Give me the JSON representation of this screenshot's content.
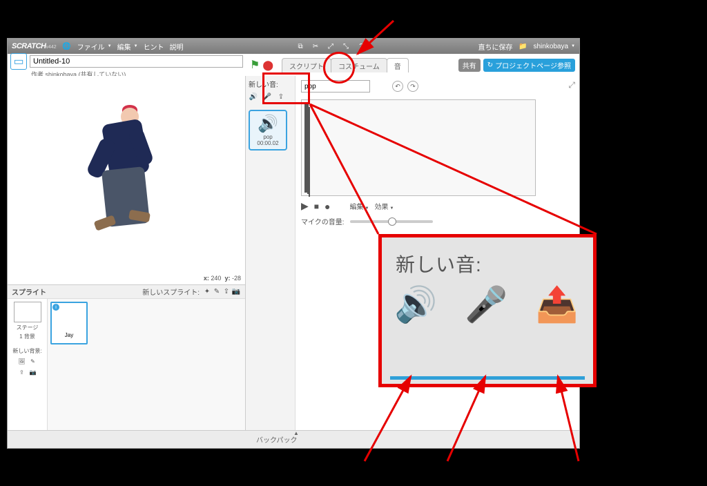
{
  "menubar": {
    "logo": "SCRATCH",
    "version": "v442",
    "globe": "🌐",
    "file": "ファイル",
    "edit": "編集",
    "hint": "ヒント",
    "about": "説明",
    "save_now": "直ちに保存",
    "username": "shinkobaya"
  },
  "titlebar": {
    "project_title": "Untitled-10",
    "author_line": "作者 shinkobaya (共有していない)"
  },
  "tabs": {
    "scripts": "スクリプト",
    "costumes": "コスチューム",
    "sounds": "音",
    "share": "共有",
    "project_page": "プロジェクトページ参照"
  },
  "stage": {
    "coords_prefix_x": "x:",
    "coords_x": "240",
    "coords_prefix_y": "y:",
    "coords_y": "-28"
  },
  "sprites": {
    "header": "スプライト",
    "new_sprite": "新しいスプライト:",
    "stage_label": "ステージ",
    "stage_sub": "1 背景",
    "new_backdrop": "新しい背景:",
    "sprite1_name": "Jay"
  },
  "newsound": {
    "label": "新しい音:",
    "sound_name": "pop",
    "sound_len": "00:00.02"
  },
  "editor": {
    "name_value": "pop",
    "edit_menu": "編集",
    "effects_menu": "効果",
    "mic_label": "マイクの音量:"
  },
  "backpack": {
    "label": "バックパック"
  },
  "zoom": {
    "label": "新しい音:"
  }
}
